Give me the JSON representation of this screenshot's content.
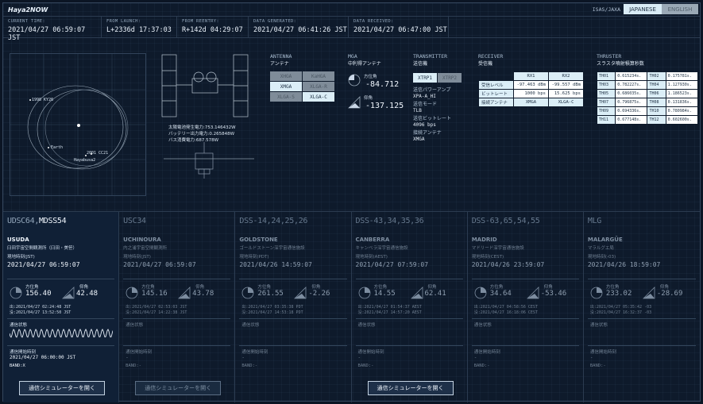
{
  "app": {
    "title": "Haya2NOW",
    "org": "ISAS/JAXA",
    "lang_jp": "JAPANESE",
    "lang_en": "ENGLISH"
  },
  "status": [
    {
      "label": "CURRENT TIME:",
      "value": "2021/04/27 06:59:07 JST"
    },
    {
      "label": "FROM LAUNCH:",
      "value": "L+2336d 17:37:03"
    },
    {
      "label": "FROM REENTRY:",
      "value": "R+142d 04:29:07"
    },
    {
      "label": "DATA GENERATED:",
      "value": "2021/04/27 06:41:26 JST"
    },
    {
      "label": "DATA RECEIVED:",
      "value": "2021/04/27 06:47:00 JST"
    }
  ],
  "orbit": {
    "label_ast": "1998 KY26",
    "label_earth": "Earth",
    "label_craft": "Hayabusa2",
    "label_2001": "2001 CC21"
  },
  "spacecraft": {
    "solar": "太陽電池発生電力:753.146432W",
    "battery": "バッテリー出力電力:0.265848W",
    "bus": "バス消費電力:687.578W"
  },
  "antenna": {
    "title": "ANTENNA",
    "sub": "アンテナ",
    "cells": [
      "XHGA",
      "KaHGA",
      "XMGA",
      "XLGA-R",
      "XLGA-S",
      "XLGA-C"
    ]
  },
  "mga": {
    "title": "MGA",
    "sub": "中利得アンテナ",
    "az_label": "方位角",
    "az_value": "-84.712",
    "el_label": "仰角",
    "el_value": "-137.125"
  },
  "transmitter": {
    "title": "TRANSMITTER",
    "sub": "送信機",
    "btn1": "XTRP1",
    "btn2": "XTRP2",
    "amp_label": "送信パワーアンプ",
    "amp_value": "XPA-A_HI",
    "mode_label": "送信モード",
    "mode_value": "TLB",
    "rate_label": "送信ビットレート",
    "rate_value": "4096 bps",
    "ant_label": "接続アンテナ",
    "ant_value": "XMGA"
  },
  "receiver": {
    "title": "RECEIVER",
    "sub": "受信機",
    "col1": "RX1",
    "col2": "RX2",
    "rows": [
      {
        "k": "受信レベル",
        "v1": "-97.463 dBm",
        "v2": "-99.557 dBm"
      },
      {
        "k": "ビットレート",
        "v1": "1000 bps",
        "v2": "15.625 bps"
      },
      {
        "k": "接続アンテナ",
        "v1": "XMGA",
        "v2": "XLGA-C"
      }
    ]
  },
  "thruster": {
    "title": "THRUSTER",
    "sub": "スラスタ噴射積算秒数",
    "rows": [
      [
        "TH01",
        "0.615234s.",
        "TH02",
        "0.175781s."
      ],
      [
        "TH03",
        "0.782227s.",
        "TH04",
        "1.127930s."
      ],
      [
        "TH05",
        "0.686035s.",
        "TH06",
        "1.186523s."
      ],
      [
        "TH07",
        "0.796875s.",
        "TH08",
        "0.131836s."
      ],
      [
        "TH09",
        "0.694336s.",
        "TH10",
        "0.780984s."
      ],
      [
        "TH11",
        "0.677148s.",
        "TH12",
        "0.602600s."
      ]
    ]
  },
  "stations": [
    {
      "name_pre": "UDSC64,",
      "name_act": "MDSS54",
      "code": "USUDA",
      "jp": "臼田宇宙空間観測所（臼田・美笹）",
      "tz": "現地時刻(JST)",
      "time": "2021/04/27 06:59:07",
      "az_label": "方位角",
      "az": "156.40",
      "el_label": "仰角",
      "el": "42.48",
      "rise": "出:2021/04/27 02:24:48 JST",
      "set": "没:2021/04/27 13:52:50 JST",
      "comm_label": "通信状態",
      "start_label": "通信開始時刻",
      "start": "2021/04/27 06:00:00 JST",
      "band": "BAND:X",
      "btn": "通信シミュレーターを開く"
    },
    {
      "name_pre": "USC34",
      "name_act": "",
      "code": "UCHINOURA",
      "jp": "内之浦宇宙空間観測所",
      "tz": "現地時刻(JST)",
      "time": "2021/04/27 06:59:07",
      "az_label": "方位角",
      "az": "145.16",
      "el_label": "仰角",
      "el": "43.78",
      "rise": "出:2021/04/27 02:53:03 JST",
      "set": "没:2021/04/27 14:22:38 JST",
      "comm_label": "通信状態",
      "start_label": "通信開始時刻",
      "start": "-",
      "band": "BAND:-",
      "btn": "通信シミュレーターを開く"
    },
    {
      "name_pre": "DSS-14,24,25,26",
      "name_act": "",
      "code": "GOLDSTONE",
      "jp": "ゴールドストーン深宇宙通信施設",
      "tz": "現地時刻(PDT)",
      "time": "2021/04/26 14:59:07",
      "az_label": "方位角",
      "az": "261.55",
      "el_label": "仰角",
      "el": "-2.26",
      "rise": "出:2021/04/27 03:35:38 PDT",
      "set": "没:2021/04/27 14:53:18 PDT",
      "comm_label": "通信状態",
      "start_label": "通信開始時刻",
      "start": "-",
      "band": "BAND:-",
      "btn": ""
    },
    {
      "name_pre": "DSS-43,34,35,36",
      "name_act": "",
      "code": "CANBERRA",
      "jp": "キャンベラ深宇宙通信施設",
      "tz": "現地時刻(AEST)",
      "time": "2021/04/27 07:59:07",
      "az_label": "方位角",
      "az": "14.55",
      "el_label": "仰角",
      "el": "62.41",
      "rise": "出:2021/04/27 01:54:37 AEST",
      "set": "没:2021/04/27 14:57:20 AEST",
      "comm_label": "通信状態",
      "start_label": "通信開始時刻",
      "start": "-",
      "band": "BAND:-",
      "btn": "通信シミュレーターを開く"
    },
    {
      "name_pre": "DSS-63,65,54,55",
      "name_act": "",
      "code": "MADRID",
      "jp": "マドリード深宇宙通信施設",
      "tz": "現地時刻(CEST)",
      "time": "2021/04/26 23:59:07",
      "az_label": "方位角",
      "az": "34.64",
      "el_label": "仰角",
      "el": "-53.46",
      "rise": "出:2021/04/27 04:58:56 CEST",
      "set": "没:2021/04/27 16:18:06 CEST",
      "comm_label": "通信状態",
      "start_label": "通信開始時刻",
      "start": "-",
      "band": "BAND:-",
      "btn": ""
    },
    {
      "name_pre": "MLG",
      "name_act": "",
      "code": "MALARGÜE",
      "jp": "マラルグエ局",
      "tz": "現地時刻(-03)",
      "time": "2021/04/26 18:59:07",
      "az_label": "方位角",
      "az": "233.02",
      "el_label": "仰角",
      "el": "-28.69",
      "rise": "出:2021/04/27 05:35:42 -03",
      "set": "没:2021/04/27 16:32:37 -03",
      "comm_label": "通信状態",
      "start_label": "通信開始時刻",
      "start": "-",
      "band": "BAND:-",
      "btn": ""
    }
  ]
}
